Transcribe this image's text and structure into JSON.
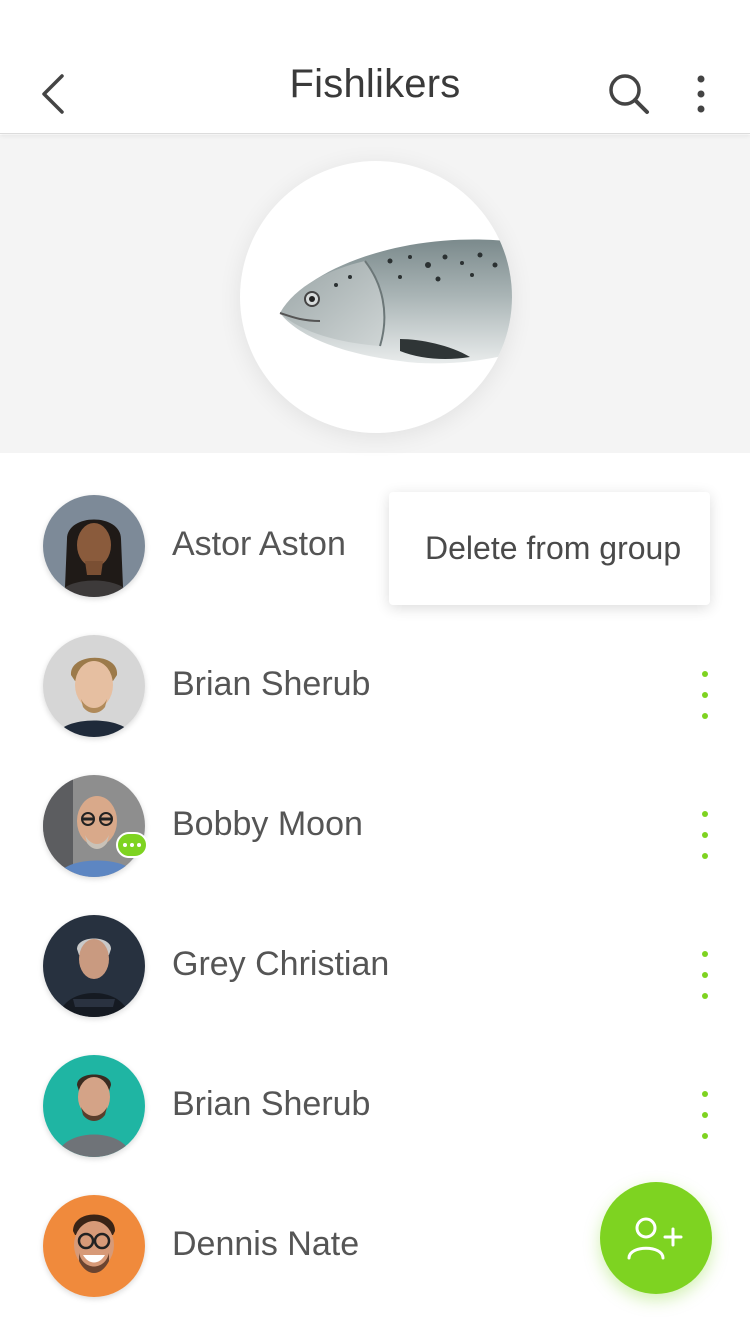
{
  "header": {
    "title": "Fishlikers",
    "back_icon": "chevron-left-icon",
    "search_icon": "search-icon",
    "more_icon": "more-vertical-icon"
  },
  "group": {
    "photo": "salmon-fish-photo"
  },
  "context_menu": {
    "item_label": "Delete from group"
  },
  "members": [
    {
      "name": "Astor Aston",
      "avatar_bg": "#7d8a98"
    },
    {
      "name": "Brian Sherub",
      "avatar_bg": "#d6d6d6"
    },
    {
      "name": "Bobby Moon",
      "avatar_bg": "#8e8e8e",
      "chat_badge": true
    },
    {
      "name": "Grey Christian",
      "avatar_bg": "#27313f"
    },
    {
      "name": "Brian Sherub",
      "avatar_bg": "#1fb5a3"
    },
    {
      "name": "Dennis Nate",
      "avatar_bg": "#f08a3c"
    }
  ],
  "fab": {
    "icon": "add-user-icon"
  },
  "colors": {
    "accent": "#7ed321",
    "header_bg": "#ffffff",
    "hero_bg": "#f4f4f4",
    "text": "#555555"
  }
}
